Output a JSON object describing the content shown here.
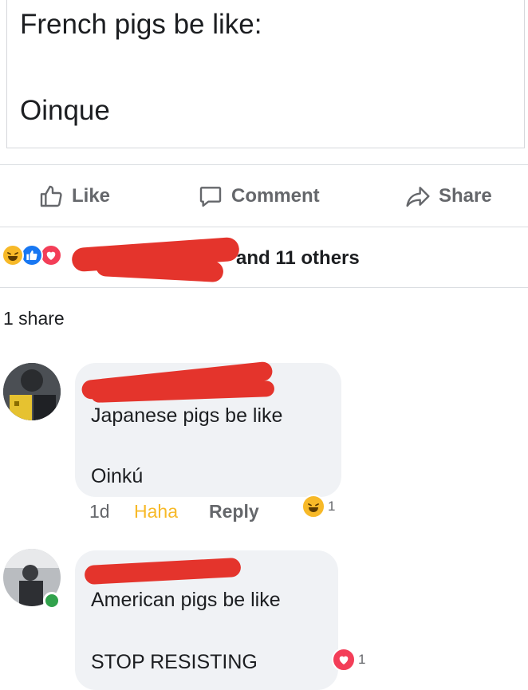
{
  "post": {
    "line1": "French pigs be like:",
    "line2": "Oinque"
  },
  "actions": {
    "like": "Like",
    "comment": "Comment",
    "share": "Share"
  },
  "reactions": {
    "others_text": "and 11 others",
    "types": [
      "haha",
      "like",
      "love"
    ]
  },
  "shares_text": "1 share",
  "comments": [
    {
      "text_line1": "Japanese pigs be like",
      "text_line2": "Oinkú",
      "time": "1d",
      "haha_label": "Haha",
      "reply_label": "Reply",
      "reaction_count": "1",
      "reaction_type": "haha"
    },
    {
      "text_line1": "American pigs be like",
      "text_line2": "STOP RESISTING",
      "reaction_count": "1",
      "reaction_type": "love",
      "online": true
    }
  ],
  "colors": {
    "like_blue": "#1877f2",
    "love_red": "#f33e58",
    "haha_yellow": "#f7b928",
    "online_green": "#31a24c",
    "redaction_red": "#e4342c"
  }
}
